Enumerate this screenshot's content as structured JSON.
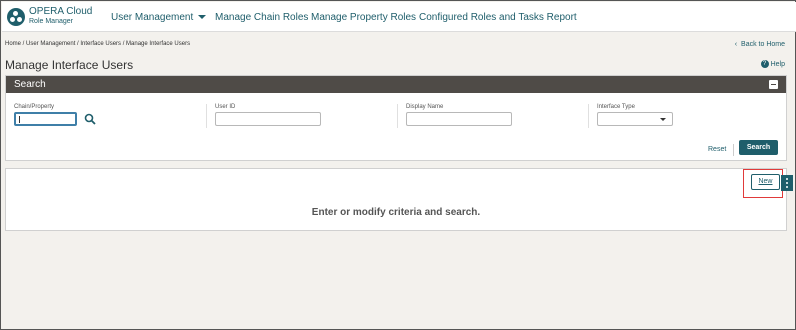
{
  "brand": {
    "title": "OPERA Cloud",
    "subtitle": "Role Manager"
  },
  "nav": {
    "items": [
      {
        "label": "User Management"
      },
      {
        "label": "Manage Chain Roles"
      },
      {
        "label": "Manage Property Roles"
      },
      {
        "label": "Configured Roles and Tasks Report"
      }
    ]
  },
  "breadcrumb": "Home / User Management / Interface Users / Manage Interface Users",
  "back_home": "Back to Home",
  "page_title": "Manage Interface Users",
  "help": "Help",
  "search": {
    "title": "Search",
    "fields": {
      "chain_property": {
        "label": "Chain/Property",
        "value": ""
      },
      "user_id": {
        "label": "User ID",
        "value": ""
      },
      "display_name": {
        "label": "Display Name",
        "value": ""
      },
      "interface_type": {
        "label": "Interface Type",
        "value": ""
      }
    },
    "reset_label": "Reset",
    "search_label": "Search"
  },
  "results": {
    "empty_message": "Enter or modify criteria and search.",
    "new_label": "New"
  },
  "colors": {
    "accent": "#1f5e6b",
    "header_bar": "#4f4b47",
    "highlight": "#e03a3a"
  },
  "icons": [
    "logo-icon",
    "chevron-down-icon",
    "chevron-left-icon",
    "help-icon",
    "collapse-icon",
    "search-icon",
    "more-vertical-icon"
  ]
}
